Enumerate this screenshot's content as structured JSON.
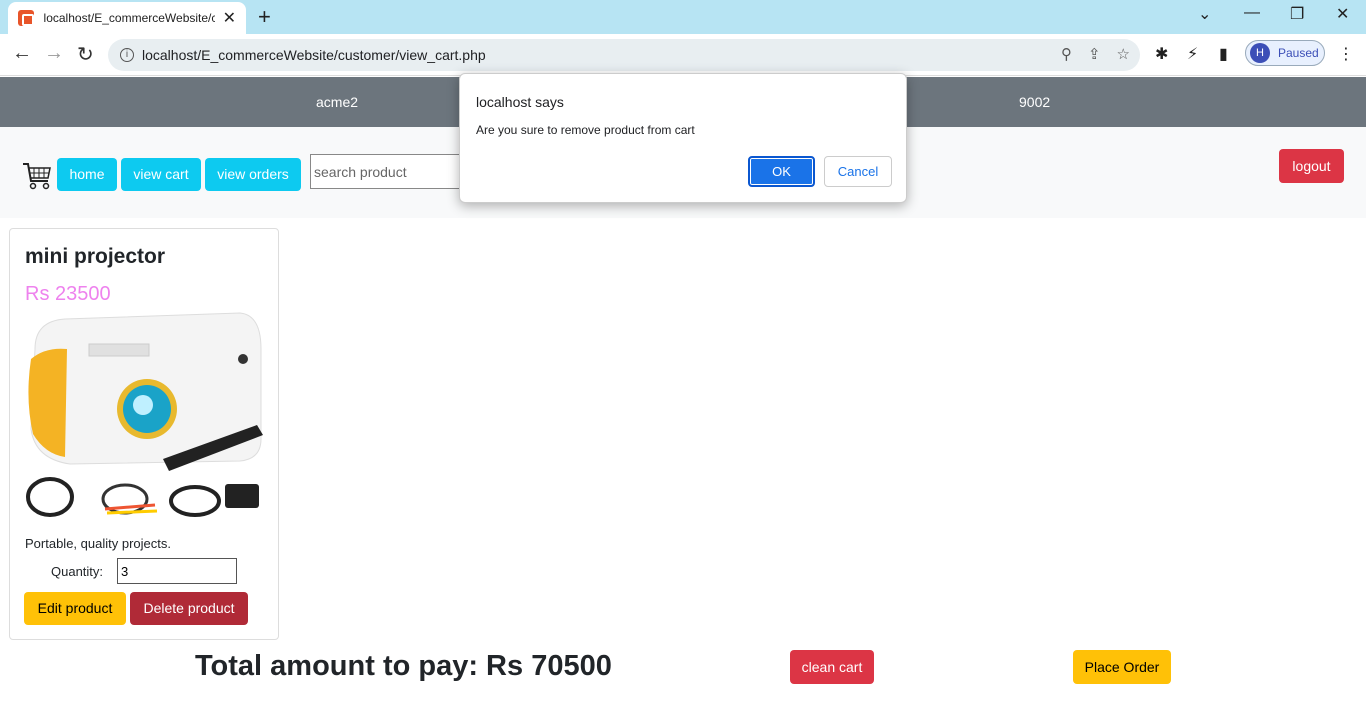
{
  "browser": {
    "tab_title": "localhost/E_commerceWebsite/cu",
    "url": "localhost/E_commerceWebsite/customer/view_cart.php",
    "profile_initial": "H",
    "profile_status": "Paused"
  },
  "topband": {
    "left_text": "acme2",
    "right_text": "9002"
  },
  "nav": {
    "home": "home",
    "view_cart": "view cart",
    "view_orders": "view orders",
    "search_placeholder": "search product",
    "logout": "logout"
  },
  "product": {
    "name": "mini projector",
    "price": "Rs 23500",
    "description": "Portable, quality projects.",
    "quantity_label": "Quantity:",
    "quantity_value": "3",
    "edit_label": "Edit product",
    "delete_label": "Delete product"
  },
  "cart": {
    "total_label": "Total amount to pay: Rs 70500",
    "clean_label": "clean cart",
    "order_label": "Place Order"
  },
  "dialog": {
    "title": "localhost says",
    "message": "Are you sure to remove product from cart",
    "ok": "OK",
    "cancel": "Cancel"
  },
  "colors": {
    "topband": "#6c757d",
    "nav_button": "#0dcaf0",
    "danger": "#dc3545",
    "warning": "#ffc107",
    "price": "#ee82ee"
  }
}
